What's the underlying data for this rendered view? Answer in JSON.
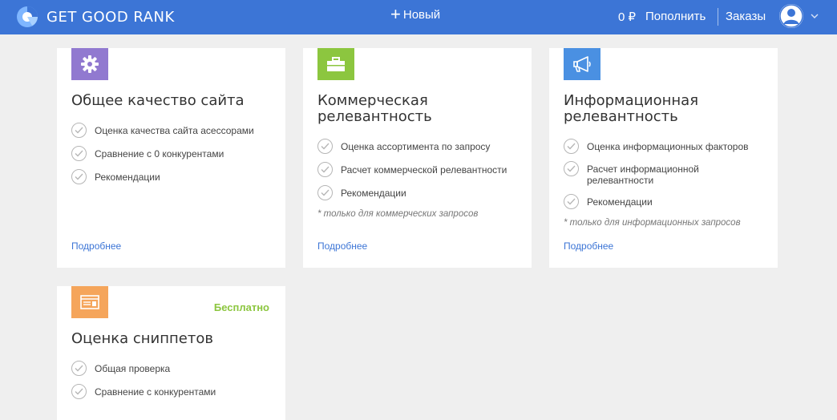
{
  "header": {
    "logo_text": "GET GOOD RANK",
    "new_label": "Новый",
    "balance": "0 ₽",
    "topup_label": "Пополнить",
    "orders_label": "Заказы"
  },
  "colors": {
    "header_bg": "#3c75d6",
    "purple": "#9179d0",
    "green": "#8cc63f",
    "blue": "#4a90e2",
    "orange": "#f5a55b"
  },
  "cards": [
    {
      "icon": "gear-icon",
      "title_lines": [
        "Общее качество сайта"
      ],
      "features": [
        "Оценка качества сайта асессорами",
        "Сравнение с 0 конкурентами",
        "Рекомендации"
      ],
      "note": "",
      "more": "Подробнее"
    },
    {
      "icon": "briefcase-icon",
      "title_lines": [
        "Коммерческая",
        "релевантность"
      ],
      "features": [
        "Оценка ассортимента по запросу",
        "Расчет коммерческой релевантности",
        "Рекомендации"
      ],
      "note": "* только для коммерческих запросов",
      "more": "Подробнее"
    },
    {
      "icon": "megaphone-icon",
      "title_lines": [
        "Информационная",
        "релевантность"
      ],
      "features": [
        "Оценка информационных факторов",
        "Расчет информационной релевантности",
        "Рекомендации"
      ],
      "note": "* только для информационных запросов",
      "more": "Подробнее"
    },
    {
      "icon": "snippet-icon",
      "badge": "Бесплатно",
      "title_lines": [
        "Оценка сниппетов"
      ],
      "features": [
        "Общая проверка",
        "Сравнение с конкурентами"
      ]
    }
  ]
}
